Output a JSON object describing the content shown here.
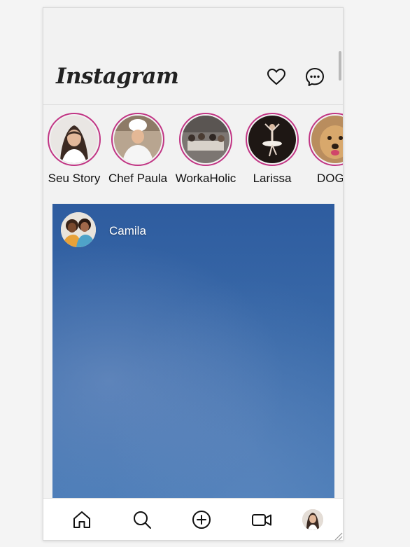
{
  "app": {
    "logo_text": "Instagram",
    "accent_color": "#c13584"
  },
  "header": {
    "icons": [
      "heart-icon",
      "messenger-icon"
    ]
  },
  "stories": [
    {
      "label": "Seu Story"
    },
    {
      "label": "Chef Paula"
    },
    {
      "label": "WorkaHolic"
    },
    {
      "label": "Larissa"
    },
    {
      "label": "DOGui"
    }
  ],
  "post": {
    "username": "Camila"
  },
  "bottom_nav": {
    "icons": [
      "home-icon",
      "search-icon",
      "add-post-icon",
      "reels-video-icon",
      "profile-avatar"
    ]
  }
}
